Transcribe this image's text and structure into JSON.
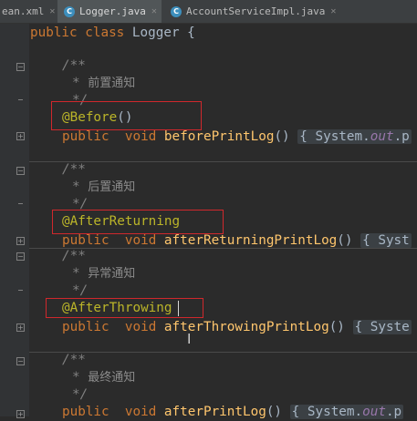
{
  "tabs": [
    {
      "label": "ean.xml"
    },
    {
      "icon": "C",
      "label": "Logger.java"
    },
    {
      "icon": "C",
      "label": "AccountServiceImpl.java"
    }
  ],
  "code": {
    "class_line": {
      "kw": "public class ",
      "name": "Logger {"
    },
    "comment_open": "/**",
    "comment_star": "*",
    "comment_close": "*/",
    "blocks": [
      {
        "comment": "前置通知",
        "annotation": "@Before",
        "annotation_tail": "()",
        "mod": "public",
        "type": "void",
        "method": "beforePrintLog",
        "tail": "() ",
        "fold": "{ System.",
        "field": "out",
        "rest": ".p"
      },
      {
        "comment": "后置通知",
        "annotation": "@AfterReturning",
        "annotation_tail": "",
        "mod": "public",
        "type": "void",
        "method": "afterReturningPrintLog",
        "tail": "() ",
        "fold": "{ Syst",
        "field": "",
        "rest": ""
      },
      {
        "comment": "异常通知",
        "annotation": "@AfterThrowing",
        "annotation_tail": "",
        "mod": "public",
        "type": "void",
        "method": "afterThrowingPrintLog",
        "tail": "() ",
        "fold": "{ Syste",
        "field": "",
        "rest": ""
      },
      {
        "comment": "最终通知",
        "annotation": "",
        "annotation_tail": "",
        "mod": "public",
        "type": "void",
        "method": "afterPrintLog",
        "tail": "() ",
        "fold": "{ System.",
        "field": "out",
        "rest": ".p"
      }
    ]
  },
  "colors": {
    "editor_bg": "#2b2b2b",
    "gutter_bg": "#313335",
    "keyword": "#cc7832",
    "annotation": "#bbb529",
    "method": "#ffc66d",
    "comment": "#808080",
    "highlight_box": "#d0282c"
  }
}
